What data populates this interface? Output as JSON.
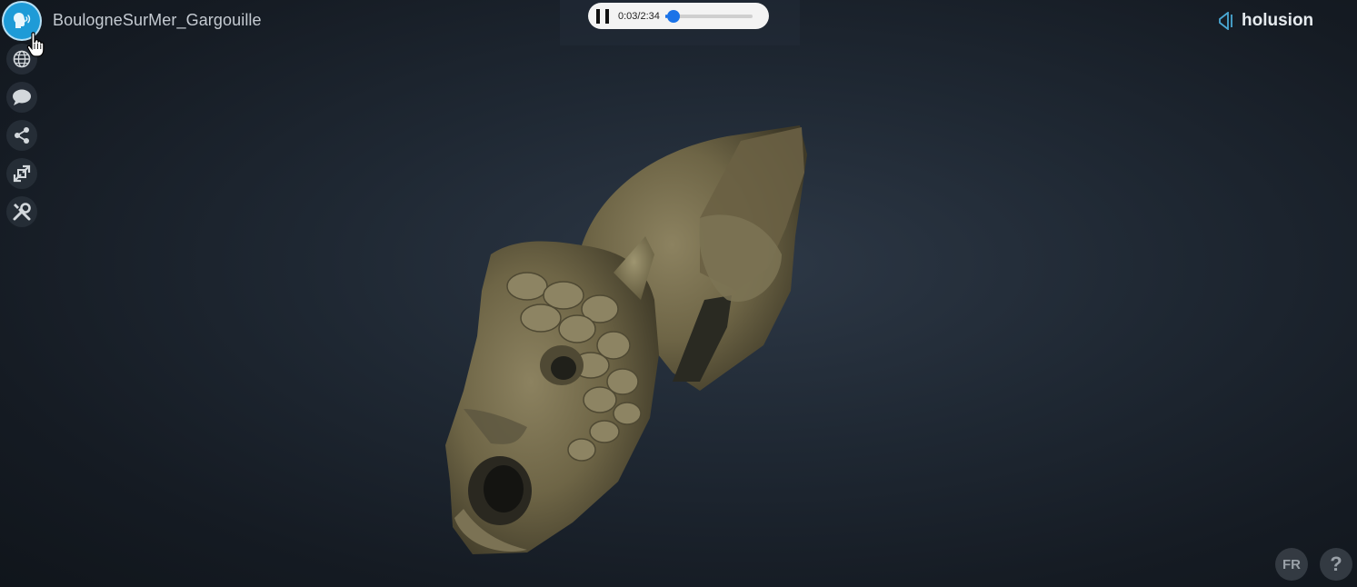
{
  "header": {
    "model_title": "BoulogneSurMer_Gargouille"
  },
  "toolbar": {
    "items": [
      {
        "name": "audio-guide",
        "icon": "speaking-head-icon",
        "active": true
      },
      {
        "name": "language-globe",
        "icon": "globe-icon"
      },
      {
        "name": "annotations",
        "icon": "speech-bubble-icon"
      },
      {
        "name": "share",
        "icon": "share-icon"
      },
      {
        "name": "fullscreen",
        "icon": "expand-icon"
      },
      {
        "name": "tools",
        "icon": "wrench-screwdriver-icon"
      }
    ]
  },
  "audio_player": {
    "state": "playing",
    "time_display": "0:03/2:34",
    "progress": 0.02
  },
  "brand": {
    "name": "holusion",
    "logo_icon": "holusion-logo-icon"
  },
  "footer": {
    "language_label": "FR",
    "help_label": "?"
  },
  "colors": {
    "accent": "#1e9bd7",
    "slider": "#1a73e8",
    "background": "#1f2833"
  }
}
